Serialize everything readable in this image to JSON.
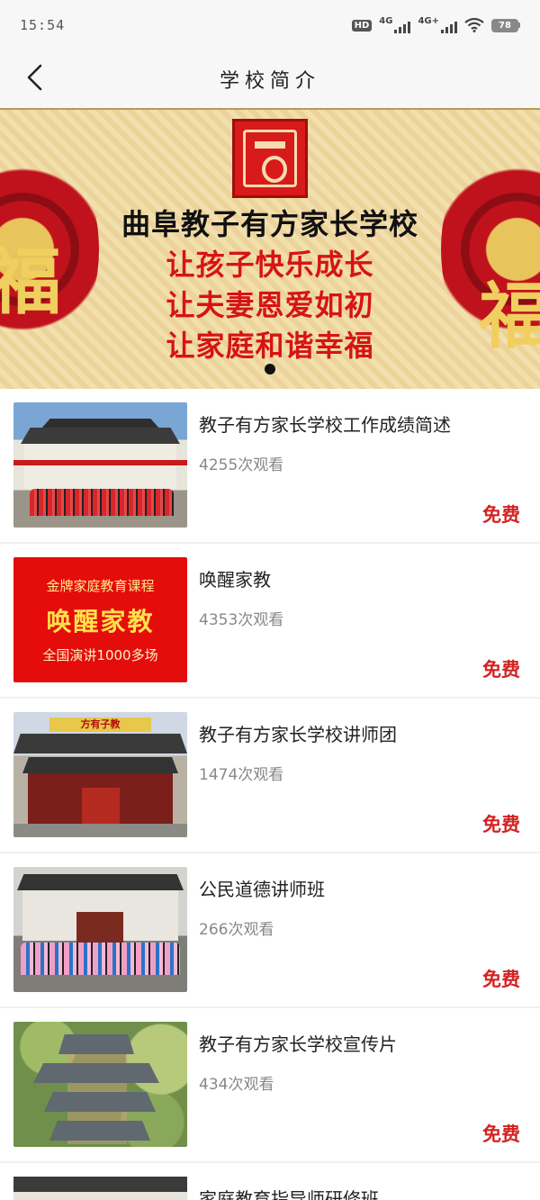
{
  "status_bar": {
    "time": "15:54",
    "hd": "HD",
    "net1": "4G",
    "net2": "4G+",
    "battery": "78"
  },
  "nav": {
    "title": "学校简介"
  },
  "banner": {
    "title": "曲阜教子有方家长学校",
    "slogans": [
      "让孩子快乐成长",
      "让夫妻恩爱如初",
      "让家庭和谐幸福"
    ],
    "side_chars": [
      "福",
      "福"
    ]
  },
  "courses": [
    {
      "title": "教子有方家长学校工作成绩简述",
      "views": "4255次观看",
      "price": "免费"
    },
    {
      "title": "唤醒家教",
      "views": "4353次观看",
      "price": "免费",
      "thumb_text": [
        "金牌家庭教育课程",
        "唤醒家教",
        "全国演讲1000多场"
      ]
    },
    {
      "title": "教子有方家长学校讲师团",
      "views": "1474次观看",
      "price": "免费",
      "thumb_text": [
        "方有子教"
      ]
    },
    {
      "title": "公民道德讲师班",
      "views": "266次观看",
      "price": "免费"
    },
    {
      "title": "教子有方家长学校宣传片",
      "views": "434次观看",
      "price": "免费"
    },
    {
      "title": "家庭教育指导师研修班"
    }
  ],
  "colors": {
    "accent_red": "#d42222",
    "banner_red": "#d61414",
    "text": "#222222",
    "muted": "#888888"
  }
}
